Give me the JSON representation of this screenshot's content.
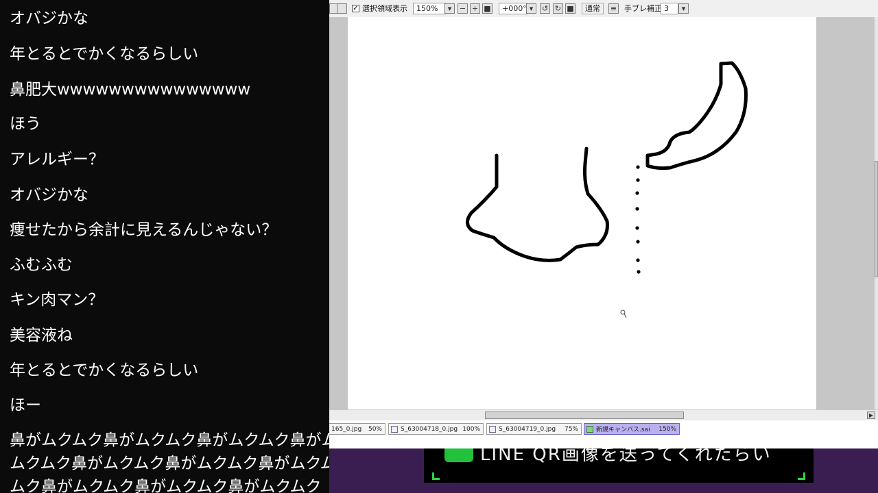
{
  "comments": [
    "オバジかな",
    "年とるとでかくなるらしい",
    "鼻肥大wwwwwwwwwwwwwww",
    "ほう",
    "アレルギー？",
    "オバジかな",
    "痩せたから余計に見えるんじゃない？",
    "ふむふむ",
    "キン肉マン？",
    "美容液ね",
    "年とるとでかくなるらしい",
    "ほー",
    "鼻がムクムク鼻がムクムク鼻がムクムク鼻がム",
    "ムクムク鼻がムクムク鼻がムクムク鼻がムクム",
    "ムク鼻がムクムク鼻がムクムク鼻がムクムク"
  ],
  "toolbar": {
    "selection_checkbox_mark": "✓",
    "selection_label": "選択領域表示",
    "zoom_value": "150%",
    "rotation_value": "+000°",
    "blend_mode": "通常",
    "stabilizer_label": "手ブレ補正",
    "stabilizer_value": "3"
  },
  "tabs": [
    {
      "name": "165_0.jpg",
      "zoom": "50%"
    },
    {
      "name": "S_63004718_0.jpg",
      "zoom": "100%"
    },
    {
      "name": "S_63004719_0.jpg",
      "zoom": "75%"
    },
    {
      "name": "新規キャンバス.sai",
      "zoom": "150%"
    }
  ],
  "banner": {
    "text": "LINE QR画像を送ってくれたらい"
  },
  "colors": {
    "comment_bg": "#0b0b0b",
    "comment_text": "#ffffff",
    "active_tab": "#b9b0f0",
    "banner_bg": "#3a1e52",
    "line_green": "#22c13b"
  },
  "icons": [
    "checkbox-icon",
    "dropdown-arrow-icon",
    "zoom-out-icon",
    "zoom-in-icon",
    "zoom-reset-icon",
    "rotate-left-icon",
    "rotate-right-icon",
    "rotate-reset-icon",
    "stabilizer-icon",
    "line-logo-icon",
    "pen-cursor-icon"
  ]
}
